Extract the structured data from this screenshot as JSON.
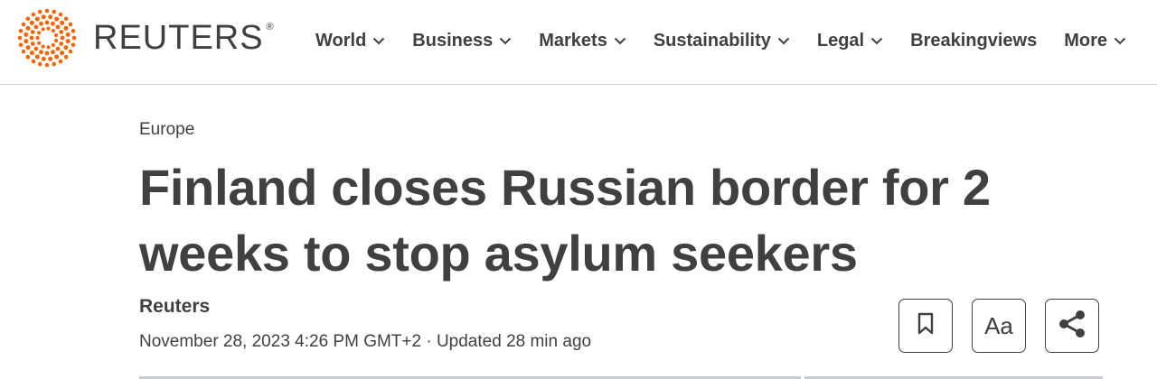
{
  "brand": {
    "name": "REUTERS",
    "registered": "®",
    "accent": "#fa6400"
  },
  "nav": {
    "items": [
      {
        "label": "World",
        "dropdown": true
      },
      {
        "label": "Business",
        "dropdown": true
      },
      {
        "label": "Markets",
        "dropdown": true
      },
      {
        "label": "Sustainability",
        "dropdown": true
      },
      {
        "label": "Legal",
        "dropdown": true
      },
      {
        "label": "Breakingviews",
        "dropdown": false
      },
      {
        "label": "More",
        "dropdown": true
      }
    ]
  },
  "article": {
    "section": "Europe",
    "headline": "Finland closes Russian border for 2 weeks to stop asylum seekers",
    "byline": "Reuters",
    "dateline": "November 28, 2023 4:26 PM GMT+2 · Updated 28 min ago"
  },
  "tools": {
    "bookmark_icon": "bookmark-icon",
    "text_size_label": "Aa",
    "share_icon": "share-icon"
  },
  "colors": {
    "text": "#404040",
    "divider": "#cfcfcf"
  }
}
